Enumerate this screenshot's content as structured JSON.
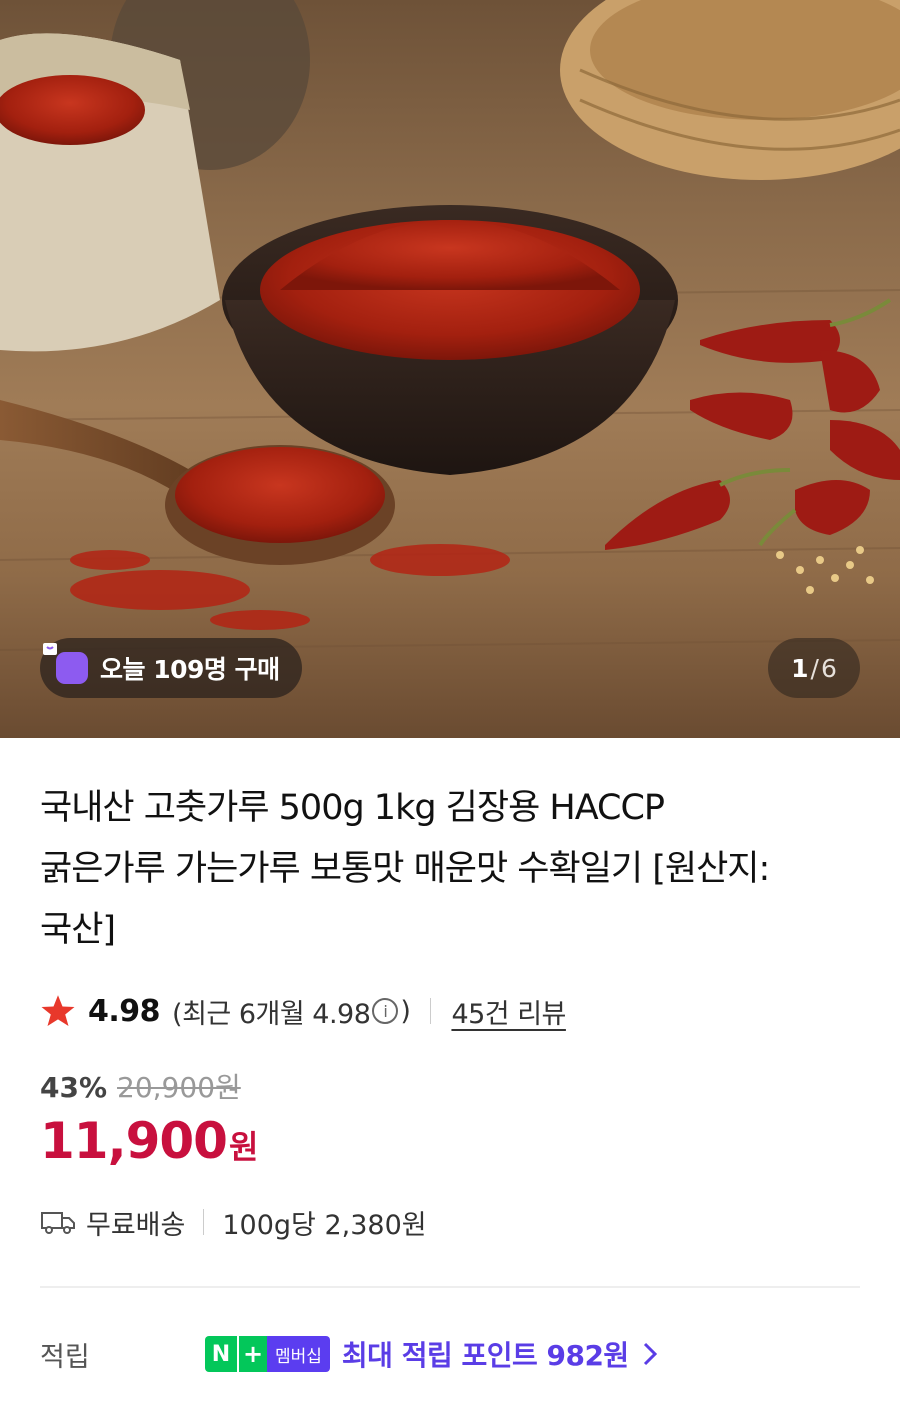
{
  "hero": {
    "today_badge": "오늘 109명 구매",
    "pager": {
      "current": "1",
      "separator": "/",
      "total": "6"
    }
  },
  "product": {
    "title_lines": [
      "국내산 고춧가루 500g 1kg 김장용 HACCP",
      "굵은가루 가는가루 보통맛 매운맛 수확일기 [원산지:",
      "국산]"
    ],
    "rating": {
      "score": "4.98",
      "recent_prefix": "(최근 6개월 4.98",
      "info_glyph": "i",
      "recent_suffix": ")",
      "reviews": "45건 리뷰"
    },
    "discount": "43%",
    "original_price": "20,900원",
    "price": "11,900",
    "price_unit": "원",
    "shipping": "무료배송",
    "unit_price": "100g당 2,380원"
  },
  "points": {
    "label": "적립",
    "badge_n": "N",
    "badge_plus": "+",
    "badge_membership": "멤버십",
    "text": "최대 적립 포인트 982원"
  },
  "colors": {
    "accent_price": "#c8103e",
    "points_purple": "#5a3de6",
    "naver_green": "#03c75a",
    "badge_purple": "#8d5bf0"
  },
  "icons": [
    "shopping-bag-icon",
    "star-icon",
    "info-icon",
    "truck-icon",
    "chevron-right-icon"
  ]
}
